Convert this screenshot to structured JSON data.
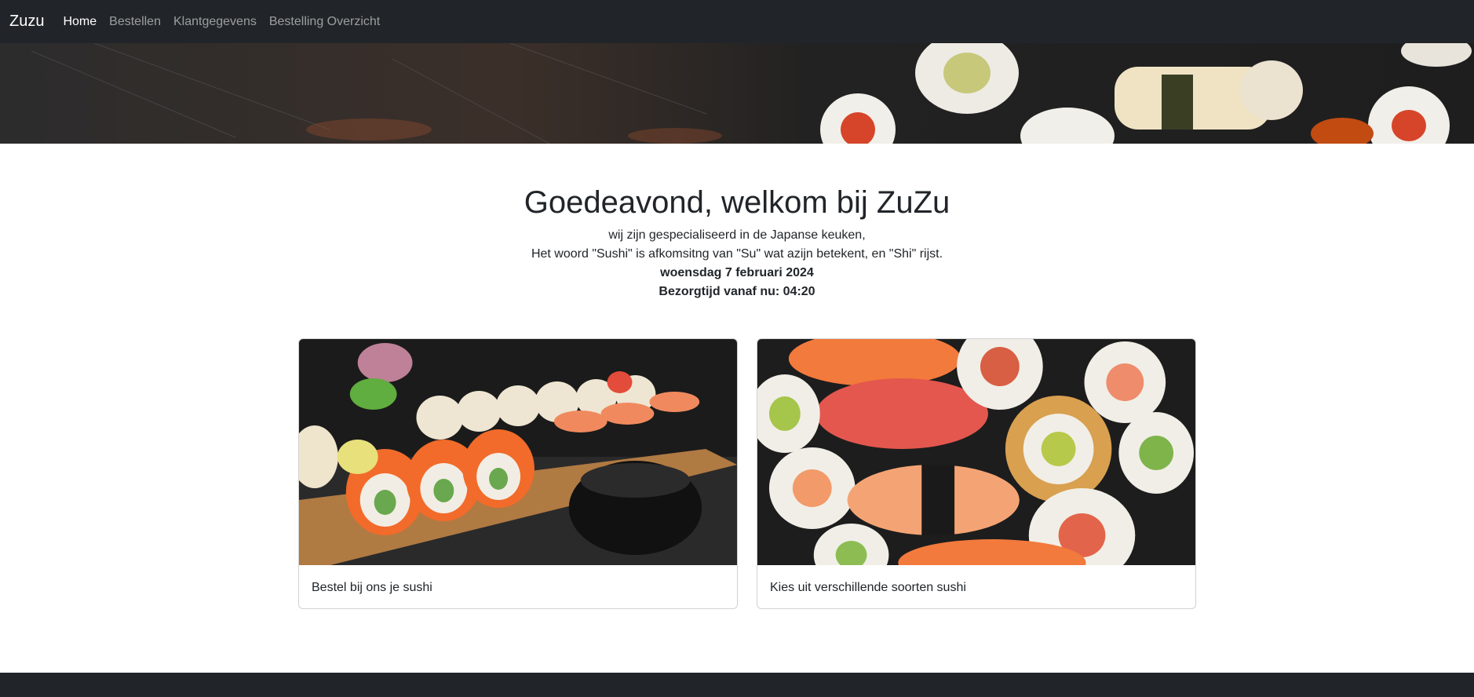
{
  "navbar": {
    "brand": "Zuzu",
    "links": [
      {
        "label": "Home",
        "active": true
      },
      {
        "label": "Bestellen",
        "active": false
      },
      {
        "label": "Klantgegevens",
        "active": false
      },
      {
        "label": "Bestelling Overzicht",
        "active": false
      }
    ]
  },
  "intro": {
    "title": "Goedeavond, welkom bij ZuZu",
    "line1": "wij zijn gespecialiseerd in de Japanse keuken,",
    "line2": "Het woord \"Sushi\" is afkomsitng van \"Su\" wat azijn betekent, en \"Shi\" rijst.",
    "date": "woensdag 7 februari 2024",
    "delivery": "Bezorgtijd vanaf nu: 04:20"
  },
  "cards": [
    {
      "text": "Bestel bij ons je sushi"
    },
    {
      "text": "Kies uit verschillende soorten sushi"
    }
  ],
  "colors": {
    "navbar_bg": "#212529",
    "nav_active": "#ffffff",
    "nav_inactive": "rgba(255,255,255,0.55)",
    "text": "#212529"
  }
}
